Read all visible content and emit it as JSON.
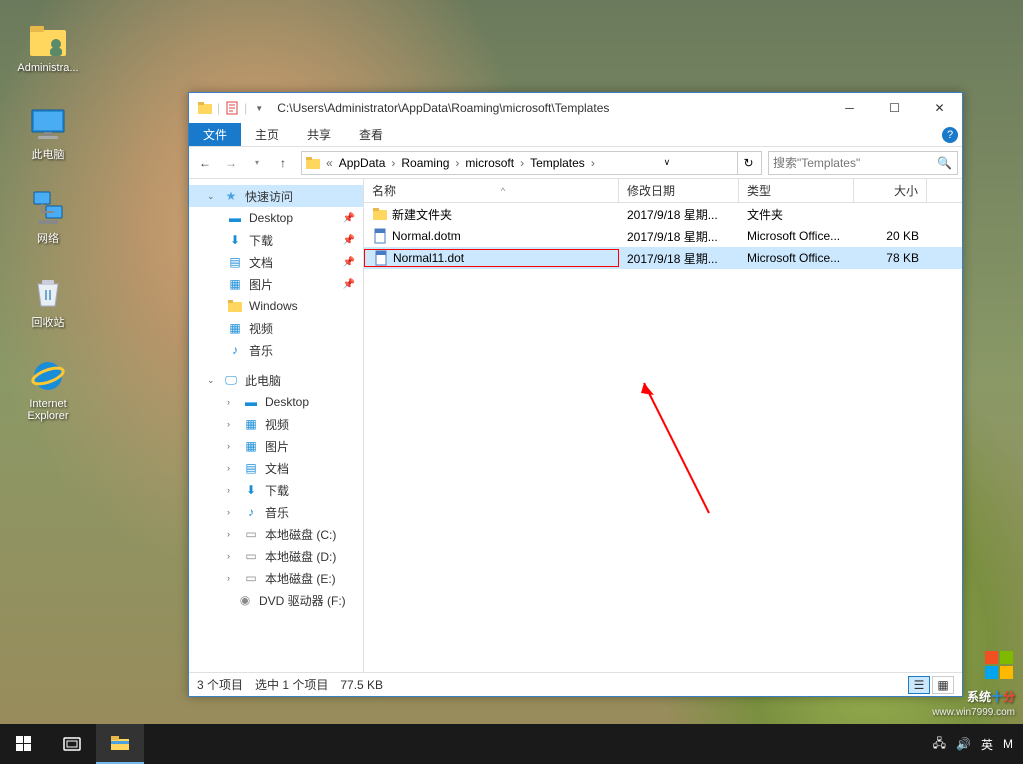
{
  "desktop": {
    "icons": [
      {
        "name": "administrator",
        "label": "Administra..."
      },
      {
        "name": "this-pc",
        "label": "此电脑"
      },
      {
        "name": "network",
        "label": "网络"
      },
      {
        "name": "recycle-bin",
        "label": "回收站"
      },
      {
        "name": "internet-explorer",
        "label": "Internet Explorer"
      }
    ]
  },
  "window": {
    "title_path": "C:\\Users\\Administrator\\AppData\\Roaming\\microsoft\\Templates",
    "ribbon": {
      "file": "文件",
      "home": "主页",
      "share": "共享",
      "view": "查看"
    },
    "breadcrumb": {
      "segments": [
        "AppData",
        "Roaming",
        "microsoft",
        "Templates"
      ],
      "overflow": "«"
    },
    "search_placeholder": "搜索\"Templates\"",
    "sidebar": {
      "quick_access": "快速访问",
      "quick_items": [
        {
          "name": "desktop",
          "label": "Desktop",
          "pinned": true
        },
        {
          "name": "downloads",
          "label": "下载",
          "pinned": true
        },
        {
          "name": "documents",
          "label": "文档",
          "pinned": true
        },
        {
          "name": "pictures",
          "label": "图片",
          "pinned": true
        },
        {
          "name": "windows",
          "label": "Windows",
          "pinned": false
        },
        {
          "name": "videos",
          "label": "视频",
          "pinned": false
        },
        {
          "name": "music",
          "label": "音乐",
          "pinned": false
        }
      ],
      "this_pc": "此电脑",
      "pc_items": [
        {
          "name": "desktop",
          "label": "Desktop"
        },
        {
          "name": "videos",
          "label": "视频"
        },
        {
          "name": "pictures",
          "label": "图片"
        },
        {
          "name": "documents",
          "label": "文档"
        },
        {
          "name": "downloads",
          "label": "下载"
        },
        {
          "name": "music",
          "label": "音乐"
        },
        {
          "name": "disk-c",
          "label": "本地磁盘 (C:)"
        },
        {
          "name": "disk-d",
          "label": "本地磁盘 (D:)"
        },
        {
          "name": "disk-e",
          "label": "本地磁盘 (E:)"
        },
        {
          "name": "dvd-f",
          "label": "DVD 驱动器 (F:)"
        }
      ]
    },
    "columns": {
      "name": "名称",
      "date": "修改日期",
      "type": "类型",
      "size": "大小",
      "sort_indicator": "^"
    },
    "files": [
      {
        "icon": "folder",
        "name": "新建文件夹",
        "date": "2017/9/18 星期...",
        "type": "文件夹",
        "size": "",
        "selected": false,
        "highlighted": false
      },
      {
        "icon": "dotm",
        "name": "Normal.dotm",
        "date": "2017/9/18 星期...",
        "type": "Microsoft Office...",
        "size": "20 KB",
        "selected": false,
        "highlighted": false
      },
      {
        "icon": "dot",
        "name": "Normal11.dot",
        "date": "2017/9/18 星期...",
        "type": "Microsoft Office...",
        "size": "78 KB",
        "selected": true,
        "highlighted": true
      }
    ],
    "statusbar": {
      "item_count": "3 个项目",
      "selection": "选中 1 个项目",
      "sel_size": "77.5 KB"
    }
  },
  "taskbar": {
    "tray": {
      "ime_lang": "英",
      "ime_mode": "M"
    }
  },
  "watermark": {
    "text_a": "系统",
    "text_b": "十",
    "text_c": "分",
    "sub": "www.win7999.com"
  }
}
